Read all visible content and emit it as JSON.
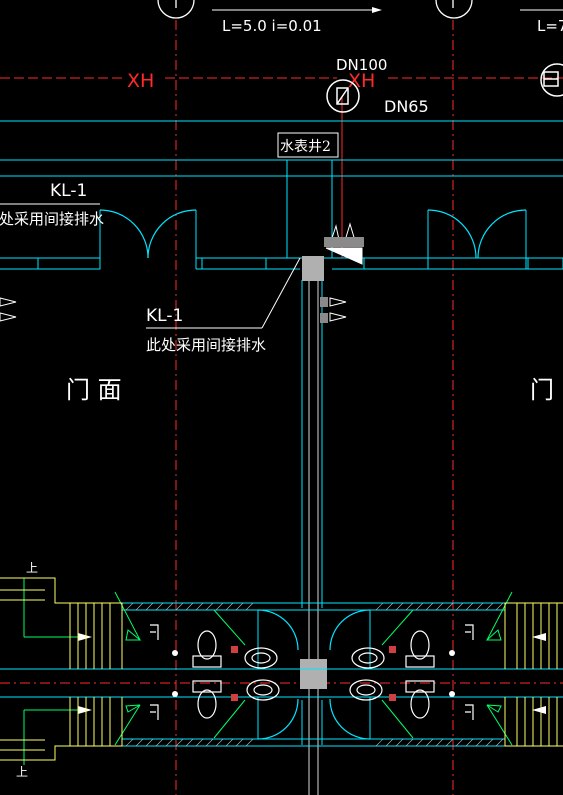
{
  "slope_left": "L=5.0  i=0.01",
  "slope_right": "L=7",
  "pipe_dn100": "DN100",
  "pipe_dn65": "DN65",
  "line_tag": "XH",
  "meter_well": "水表井2",
  "kl_tag": "KL-1",
  "drain_note": "此处采用间接排水",
  "room_label": "门 面",
  "room_label_right": "门",
  "stair_up": "上",
  "colors": {
    "background": "#000000",
    "wall": "#00e5ff",
    "axis": "#ff2a2a",
    "text": "#ffffff",
    "fixture": "#00ff66",
    "stair": "#ffff66",
    "column": "#b0b0b0"
  }
}
